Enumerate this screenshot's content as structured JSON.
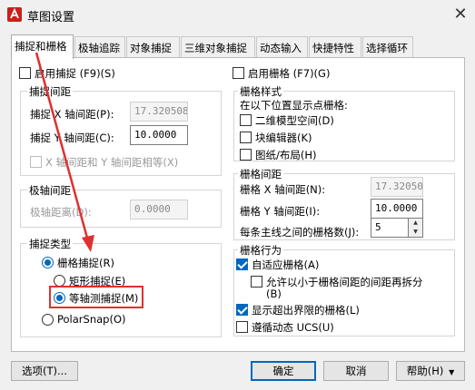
{
  "window": {
    "title": "草图设置",
    "close_symbol": "✕"
  },
  "tabs": [
    {
      "label": "捕捉和栅格"
    },
    {
      "label": "极轴追踪"
    },
    {
      "label": "对象捕捉"
    },
    {
      "label": "三维对象捕捉"
    },
    {
      "label": "动态输入"
    },
    {
      "label": "快捷特性"
    },
    {
      "label": "选择循环"
    }
  ],
  "snap": {
    "enable_label": "启用捕捉 (F9)(S)",
    "spacing_group": "捕捉间距",
    "x_label": "捕捉 X 轴间距(P):",
    "x_value": "17.3205080",
    "y_label": "捕捉 Y 轴间距(C):",
    "y_value": "10.0000",
    "equal_label": "X 轴间距和 Y 轴间距相等(X)",
    "polar_group": "极轴间距",
    "polar_label": "极轴距离(D):",
    "polar_value": "0.0000",
    "type_group": "捕捉类型",
    "grid_snap_label": "栅格捕捉(R)",
    "rect_snap_label": "矩形捕捉(E)",
    "iso_snap_label": "等轴测捕捉(M)",
    "polarsnap_label": "PolarSnap(O)"
  },
  "grid": {
    "enable_label": "启用栅格 (F7)(G)",
    "style_group": "栅格样式",
    "style_desc": "在以下位置显示点栅格:",
    "model_label": "二维模型空间(D)",
    "block_label": "块编辑器(K)",
    "sheet_label": "图纸/布局(H)",
    "spacing_group": "栅格间距",
    "x_label": "栅格 X 轴间距(N):",
    "x_value": "17.3205080",
    "y_label": "栅格 Y 轴间距(I):",
    "y_value": "10.0000",
    "major_label": "每条主线之间的栅格数(J):",
    "major_value": "5",
    "behavior_group": "栅格行为",
    "adaptive_label": "自适应栅格(A)",
    "subdivide_label": "允许以小于栅格间距的间距再拆分",
    "subdivide_label2": "(B)",
    "beyond_label": "显示超出界限的栅格(L)",
    "follow_ucs_label": "遵循动态 UCS(U)"
  },
  "buttons": {
    "options": "选项(T)...",
    "ok": "确定",
    "cancel": "取消",
    "help": "帮助(H)",
    "help_arrow": "▼"
  },
  "colors": {
    "accent": "#0067c0",
    "annotation": "#e03030"
  }
}
